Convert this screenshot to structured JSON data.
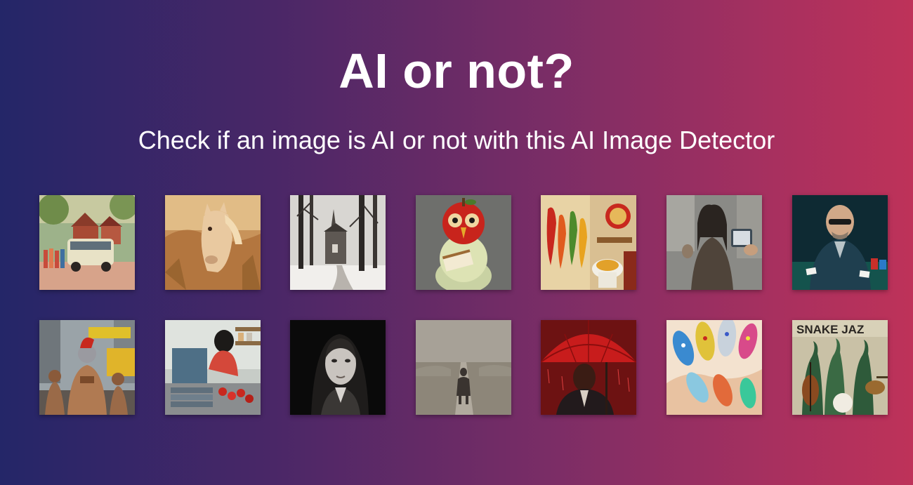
{
  "header": {
    "title": "AI or not?",
    "subtitle": "Check if an image is AI or not with this AI Image Detector"
  },
  "gallery": {
    "rows": [
      [
        "vintage-bus-street-photo",
        "horse-in-grass-photo",
        "winter-church-trees-photo",
        "apple-character-reading-photo",
        "chili-pepper-bathroom-photo",
        "street-figure-phone-photo",
        "bald-man-poker-photo"
      ],
      [
        "warriors-city-street-photo",
        "kitchen-woman-tomatoes-photo",
        "bw-woman-portrait-photo",
        "figure-in-fog-photo",
        "man-red-umbrella-photo",
        "decorated-nails-photo",
        "snake-jazz-album-photo"
      ]
    ],
    "album_text": "SNAKE JAZ"
  },
  "colors": {
    "gradient_left": "#242668",
    "gradient_right": "#be3259",
    "text": "#ffffff"
  }
}
